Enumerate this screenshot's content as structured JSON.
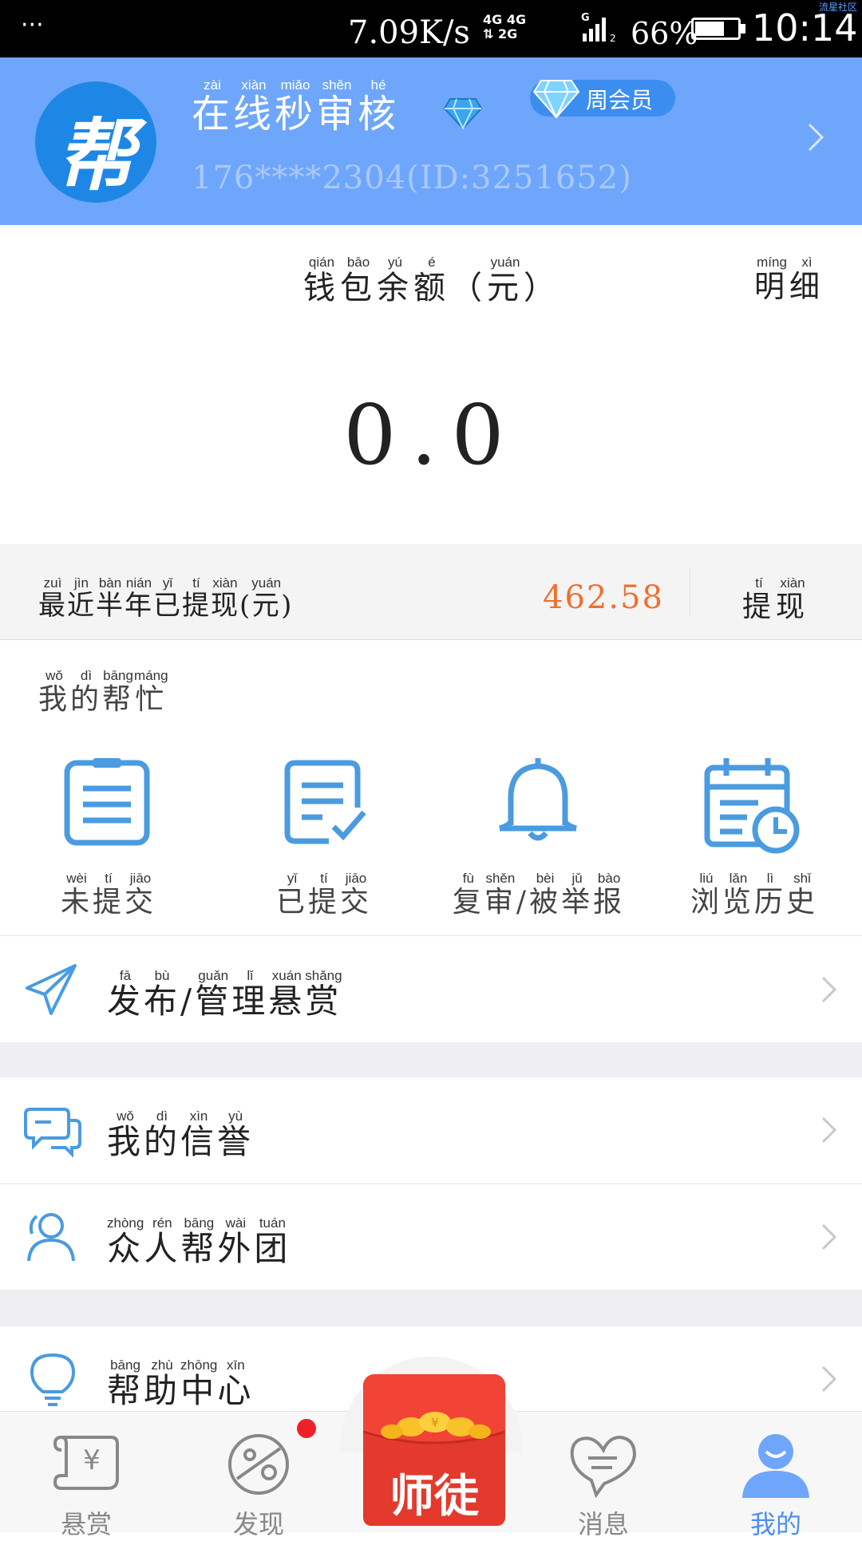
{
  "status_bar": {
    "dots": "···",
    "speed": "7.09K/s",
    "network_1": "4G",
    "network_2": "4G",
    "network_3": "2G",
    "network_4": "G",
    "battery": "66%",
    "time": "10:14",
    "corner": "流星社区"
  },
  "header": {
    "logo_char": "帮",
    "username_chars": [
      {
        "char": "在",
        "py": "zài"
      },
      {
        "char": "线",
        "py": "xiàn"
      },
      {
        "char": "秒",
        "py": "miǎo"
      },
      {
        "char": "审",
        "py": "shěn"
      },
      {
        "char": "核",
        "py": "hé"
      }
    ],
    "vip_label": "周会员",
    "user_id": "176****2304(ID:3251652)"
  },
  "wallet": {
    "title_chars": [
      {
        "char": "钱",
        "py": "qián"
      },
      {
        "char": "包",
        "py": "bāo"
      },
      {
        "char": "余",
        "py": "yú"
      },
      {
        "char": "额",
        "py": "é"
      },
      {
        "char": "（",
        "py": ""
      },
      {
        "char": "元",
        "py": "yuán"
      },
      {
        "char": "）",
        "py": ""
      }
    ],
    "detail_chars": [
      {
        "char": "明",
        "py": "míng"
      },
      {
        "char": "细",
        "py": "xì"
      }
    ],
    "balance": "0.0"
  },
  "withdraw": {
    "label_chars": [
      {
        "char": "最",
        "py": "zuì"
      },
      {
        "char": "近",
        "py": "jìn"
      },
      {
        "char": "半",
        "py": "bàn"
      },
      {
        "char": "年",
        "py": "nián"
      },
      {
        "char": "已",
        "py": "yǐ"
      },
      {
        "char": "提",
        "py": "tí"
      },
      {
        "char": "现",
        "py": "xiàn"
      },
      {
        "char": "(",
        "py": ""
      },
      {
        "char": "元",
        "py": "yuán"
      },
      {
        "char": ")",
        "py": ""
      }
    ],
    "amount": "462.58",
    "button_chars": [
      {
        "char": "提",
        "py": "tí"
      },
      {
        "char": "现",
        "py": "xiàn"
      }
    ]
  },
  "my_help": {
    "title_chars": [
      {
        "char": "我",
        "py": "wǒ"
      },
      {
        "char": "的",
        "py": "dì"
      },
      {
        "char": "帮",
        "py": "bāng"
      },
      {
        "char": "忙",
        "py": "máng"
      }
    ],
    "items": [
      {
        "icon": "clipboard-icon",
        "chars": [
          {
            "char": "未",
            "py": "wèi"
          },
          {
            "char": "提",
            "py": "tí"
          },
          {
            "char": "交",
            "py": "jiāo"
          }
        ]
      },
      {
        "icon": "submitted-doc-icon",
        "chars": [
          {
            "char": "已",
            "py": "yǐ"
          },
          {
            "char": "提",
            "py": "tí"
          },
          {
            "char": "交",
            "py": "jiāo"
          }
        ]
      },
      {
        "icon": "bell-icon",
        "chars": [
          {
            "char": "复",
            "py": "fù"
          },
          {
            "char": "审",
            "py": "shěn"
          },
          {
            "char": "/",
            "py": ""
          },
          {
            "char": "被",
            "py": "bèi"
          },
          {
            "char": "举",
            "py": "jǔ"
          },
          {
            "char": "报",
            "py": "bào"
          }
        ]
      },
      {
        "icon": "calendar-clock-icon",
        "chars": [
          {
            "char": "浏",
            "py": "liú"
          },
          {
            "char": "览",
            "py": "lǎn"
          },
          {
            "char": "历",
            "py": "lì"
          },
          {
            "char": "史",
            "py": "shǐ"
          }
        ]
      }
    ]
  },
  "list": [
    {
      "icon": "paper-plane-icon",
      "chars": [
        {
          "char": "发",
          "py": "fā"
        },
        {
          "char": "布",
          "py": "bù"
        },
        {
          "char": "/",
          "py": ""
        },
        {
          "char": "管",
          "py": "guǎn"
        },
        {
          "char": "理",
          "py": "lǐ"
        },
        {
          "char": "悬",
          "py": "xuán"
        },
        {
          "char": "赏",
          "py": "shǎng"
        }
      ]
    },
    {
      "icon": "chat-bubbles-icon",
      "chars": [
        {
          "char": "我",
          "py": "wǒ"
        },
        {
          "char": "的",
          "py": "dì"
        },
        {
          "char": "信",
          "py": "xìn"
        },
        {
          "char": "誉",
          "py": "yù"
        }
      ]
    },
    {
      "icon": "users-icon",
      "chars": [
        {
          "char": "众",
          "py": "zhòng"
        },
        {
          "char": "人",
          "py": "rén"
        },
        {
          "char": "帮",
          "py": "bāng"
        },
        {
          "char": "外",
          "py": "wài"
        },
        {
          "char": "团",
          "py": "tuán"
        }
      ]
    },
    {
      "icon": "lightbulb-icon",
      "chars": [
        {
          "char": "帮",
          "py": "bāng"
        },
        {
          "char": "助",
          "py": "zhù"
        },
        {
          "char": "中",
          "py": "zhōng"
        },
        {
          "char": "心",
          "py": "xīn"
        }
      ]
    }
  ],
  "nav": {
    "items": [
      {
        "label": "悬赏",
        "icon": "scroll-yuan-icon"
      },
      {
        "label": "发现",
        "icon": "planet-icon"
      },
      {
        "label": "师徒",
        "icon": "red-envelope-icon"
      },
      {
        "label": "消息",
        "icon": "heart-chat-icon"
      },
      {
        "label": "我的",
        "icon": "user-avatar-icon"
      }
    ],
    "active_color": "#4d8ef5"
  },
  "colors": {
    "header_bg": "#6ea6fb",
    "accent_orange": "#f07030",
    "icon_blue": "#4a9be0"
  }
}
